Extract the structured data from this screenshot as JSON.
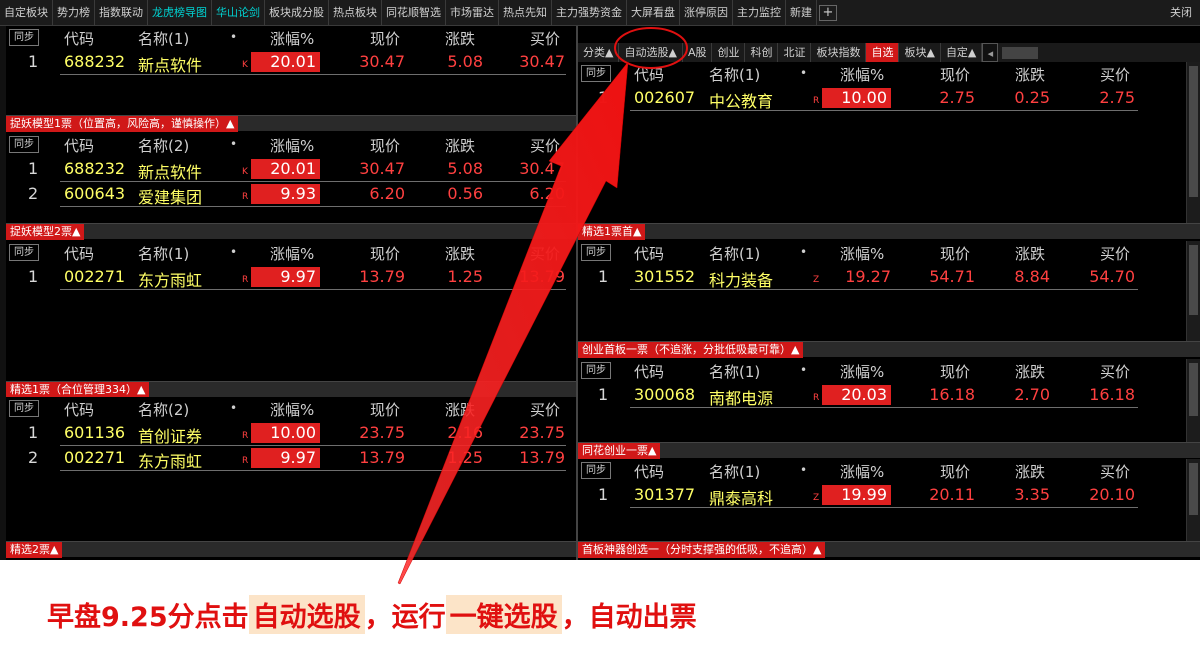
{
  "topbar": {
    "tabs": [
      "自定板块",
      "势力榜",
      "指数联动",
      "龙虎榜导图",
      "华山论剑",
      "板块成分股",
      "热点板块",
      "同花顺智选",
      "市场雷达",
      "热点先知",
      "主力强势资金",
      "大屏看盘",
      "涨停原因",
      "主力监控",
      "新建"
    ],
    "add_label": "+",
    "close_label": "关闭"
  },
  "columns": {
    "sync": "同步",
    "code": "代码",
    "name1": "名称(1)",
    "name2": "名称(2)",
    "dot": "•",
    "chg": "涨幅%",
    "price": "现价",
    "diff": "涨跌",
    "bid": "买价"
  },
  "left_panels": [
    {
      "name_col": "名称(1)",
      "rows": [
        {
          "idx": "1",
          "code": "688232",
          "name": "新点软件",
          "tag": "K",
          "chg": "20.01",
          "price": "30.47",
          "diff": "5.08",
          "bid": "30.47"
        }
      ],
      "footer": "捉妖模型1票（位置高，风险高，谨慎操作）▲"
    },
    {
      "name_col": "名称(2)",
      "rows": [
        {
          "idx": "1",
          "code": "688232",
          "name": "新点软件",
          "tag": "K",
          "chg": "20.01",
          "price": "30.47",
          "diff": "5.08",
          "bid": "30.47"
        },
        {
          "idx": "2",
          "code": "600643",
          "name": "爱建集团",
          "tag": "R",
          "chg": "9.93",
          "price": "6.20",
          "diff": "0.56",
          "bid": "6.20"
        }
      ],
      "footer": "捉妖模型2票▲"
    },
    {
      "name_col": "名称(1)",
      "rows": [
        {
          "idx": "1",
          "code": "002271",
          "name": "东方雨虹",
          "tag": "R",
          "chg": "9.97",
          "price": "13.79",
          "diff": "1.25",
          "bid": "13.79"
        }
      ],
      "footer": "精选1票（合位管理334）▲"
    },
    {
      "name_col": "名称(2)",
      "rows": [
        {
          "idx": "1",
          "code": "601136",
          "name": "首创证券",
          "tag": "R",
          "chg": "10.00",
          "price": "23.75",
          "diff": "2.16",
          "bid": "23.75"
        },
        {
          "idx": "2",
          "code": "002271",
          "name": "东方雨虹",
          "tag": "R",
          "chg": "9.97",
          "price": "13.79",
          "diff": "1.25",
          "bid": "13.79"
        }
      ],
      "footer": "精选2票▲"
    }
  ],
  "right_tabs": [
    "分类▲",
    "自动选股▲",
    "A股",
    "创业",
    "科创",
    "北证",
    "板块指数",
    "自选",
    "板块▲",
    "自定▲"
  ],
  "right_selected_tab": "自选",
  "right_panels": [
    {
      "rows": [
        {
          "idx": "1",
          "code": "002607",
          "name": "中公教育",
          "tag": "R",
          "chg": "10.00",
          "price": "2.75",
          "diff": "0.25",
          "bid": "2.75"
        }
      ],
      "footer": "精选1票首▲"
    },
    {
      "rows": [
        {
          "idx": "1",
          "code": "301552",
          "name": "科力装备",
          "tag": "Z",
          "chg": "19.27",
          "price": "54.71",
          "diff": "8.84",
          "bid": "54.70",
          "chg_plain": true
        }
      ],
      "footer": "创业首板一票（不追涨，分批低吸最可靠）▲"
    },
    {
      "rows": [
        {
          "idx": "1",
          "code": "300068",
          "name": "南都电源",
          "tag": "R",
          "chg": "20.03",
          "price": "16.18",
          "diff": "2.70",
          "bid": "16.18"
        }
      ],
      "footer": "同花创业一票▲"
    },
    {
      "rows": [
        {
          "idx": "1",
          "code": "301377",
          "name": "鼎泰高科",
          "tag": "Z",
          "chg": "19.99",
          "price": "20.11",
          "diff": "3.35",
          "bid": "20.10"
        }
      ],
      "footer": "首板神器创选一（分时支撑强的低吸，不追高）▲"
    }
  ],
  "caption": {
    "part1": "早盘9.25分点击",
    "hl1": "自动选股",
    "part2": "，运行",
    "hl2": "一键选股",
    "part3": "，自动出票"
  },
  "colors": {
    "up_red": "#ff4040",
    "stock_yellow": "#ffff66",
    "active_cyan": "#00d4d4",
    "annotation_red": "#e01010"
  }
}
